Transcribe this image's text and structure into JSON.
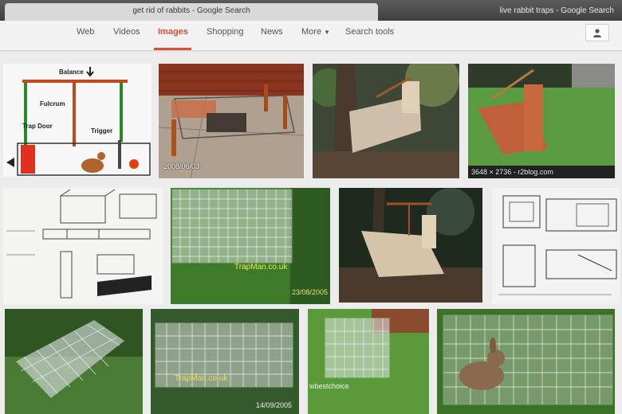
{
  "browser": {
    "active_tab_title": "get rid of rabbits - Google Search",
    "other_tab_title": "live rabbit traps - Google Search"
  },
  "nav": {
    "items": [
      "Web",
      "Videos",
      "Images",
      "Shopping",
      "News",
      "More",
      "Search tools"
    ],
    "active": "Images"
  },
  "colors": {
    "active_accent": "#dd4b39",
    "nav_text": "#555555",
    "nav_bg": "#f2f2f2"
  },
  "icons": {
    "account": "person-icon",
    "more_caret": "caret-down-icon"
  },
  "results": {
    "diagram_labels": [
      "Balance",
      "Fulcrum",
      "Trap Door",
      "Trigger"
    ],
    "r1_timestamp": "2008/06/03",
    "r3_dimensions": "3648 × 2736 - r2blog.com",
    "r5_watermark": "TrapMan.co.uk",
    "r5_date": "23/08/2005",
    "r9_watermark": "TrapMan.co.uk",
    "r9_date": "14/09/2005",
    "r10_watermark": "wbestchoice"
  }
}
